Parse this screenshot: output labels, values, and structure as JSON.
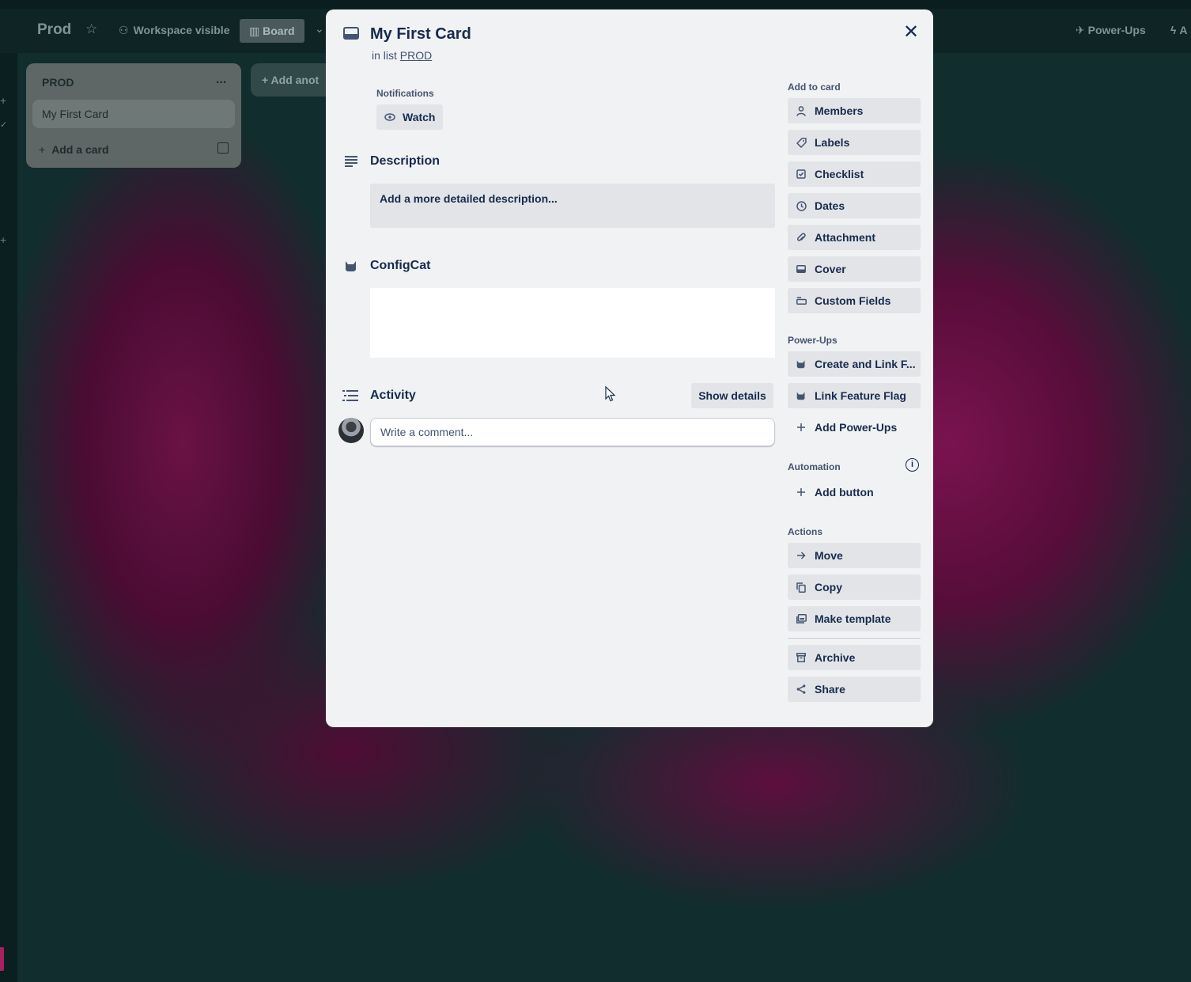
{
  "board": {
    "title": "Prod",
    "visibility": "Workspace visible",
    "view": "Board",
    "powerups": "Power-Ups",
    "automation_short": "A",
    "list": {
      "title": "PROD",
      "menu": "...",
      "cards": [
        "My First Card"
      ],
      "add_card": "Add a card"
    },
    "add_another": "Add anot"
  },
  "modal": {
    "title": "My First Card",
    "in_list_prefix": "in list",
    "in_list_name": "PROD",
    "close": "✕",
    "notifications_label": "Notifications",
    "watch_label": "Watch",
    "description": {
      "title": "Description",
      "placeholder": "Add a more detailed description..."
    },
    "configcat": {
      "title": "ConfigCat"
    },
    "activity": {
      "title": "Activity",
      "show_details": "Show details",
      "comment_placeholder": "Write a comment..."
    },
    "sidebar": {
      "add_to_card_label": "Add to card",
      "add_to_card": [
        {
          "label": "Members",
          "icon": "person-icon"
        },
        {
          "label": "Labels",
          "icon": "tag-icon"
        },
        {
          "label": "Checklist",
          "icon": "checkbox-icon"
        },
        {
          "label": "Dates",
          "icon": "clock-icon"
        },
        {
          "label": "Attachment",
          "icon": "paperclip-icon"
        },
        {
          "label": "Cover",
          "icon": "cover-icon"
        },
        {
          "label": "Custom Fields",
          "icon": "custom-fields-icon"
        }
      ],
      "powerups_label": "Power-Ups",
      "powerups": [
        {
          "label": "Create and Link F...",
          "icon": "configcat-icon"
        },
        {
          "label": "Link Feature Flag",
          "icon": "configcat-icon"
        },
        {
          "label": "Add Power-Ups",
          "icon": "plus-icon"
        }
      ],
      "automation_label": "Automation",
      "automation_info": "i",
      "automation": [
        {
          "label": "Add button",
          "icon": "plus-icon"
        }
      ],
      "actions_label": "Actions",
      "actions": [
        {
          "label": "Move",
          "icon": "arrow-right-icon"
        },
        {
          "label": "Copy",
          "icon": "copy-icon"
        },
        {
          "label": "Make template",
          "icon": "template-icon"
        },
        {
          "label": "Archive",
          "icon": "archive-icon"
        },
        {
          "label": "Share",
          "icon": "share-icon"
        }
      ]
    }
  },
  "colors": {
    "modal_bg": "#f1f2f4",
    "button_bg": "#e2e4e8",
    "text": "#172b4d",
    "subtle_text": "#44546f"
  }
}
